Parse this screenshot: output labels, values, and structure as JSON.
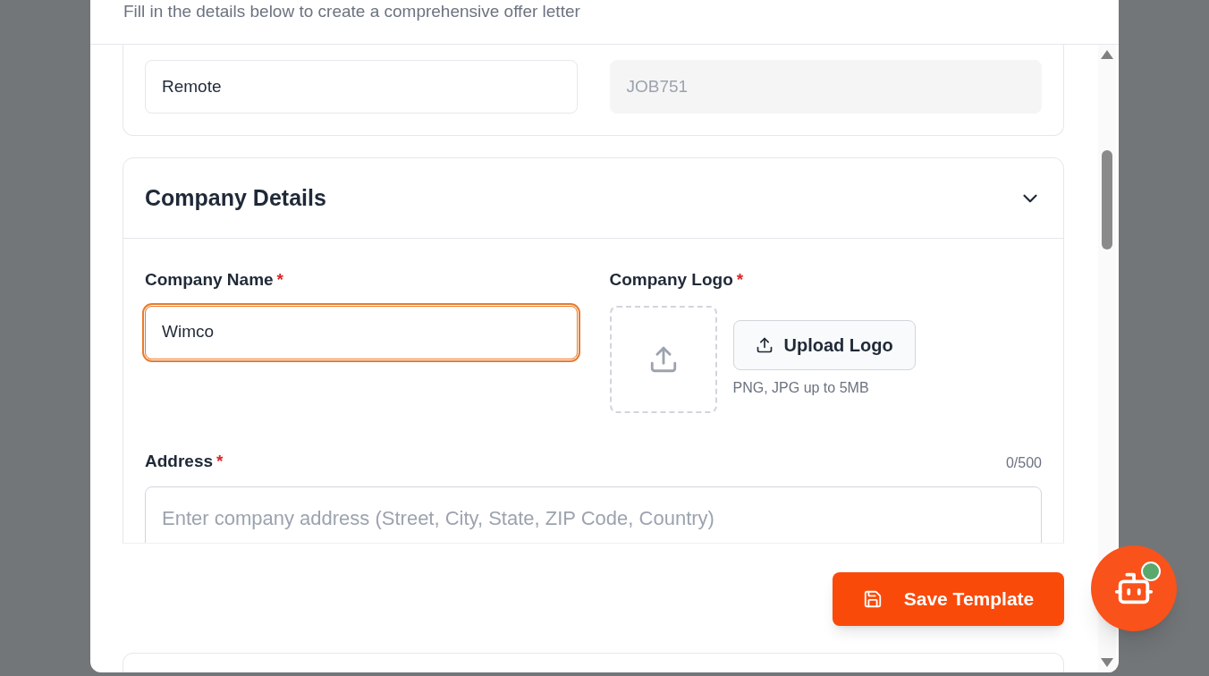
{
  "header": {
    "subtitle": "Fill in the details below to create a comprehensive offer letter"
  },
  "job_card": {
    "fields": [
      {
        "value": "Remote",
        "disabled": false
      },
      {
        "value": "JOB751",
        "disabled": true
      }
    ]
  },
  "company_card": {
    "title": "Company Details",
    "expanded": true,
    "company_name": {
      "label": "Company Name",
      "required_mark": "*",
      "value": "Wimco",
      "focused": true
    },
    "company_logo": {
      "label": "Company Logo",
      "required_mark": "*",
      "button": "Upload Logo",
      "hint": "PNG, JPG up to 5MB"
    },
    "address": {
      "label": "Address",
      "required_mark": "*",
      "counter": "0/500",
      "placeholder": "Enter company address (Street, City, State, ZIP Code, Country)"
    }
  },
  "save_button": {
    "label": "Save Template"
  },
  "assistant": {
    "online": true
  }
}
